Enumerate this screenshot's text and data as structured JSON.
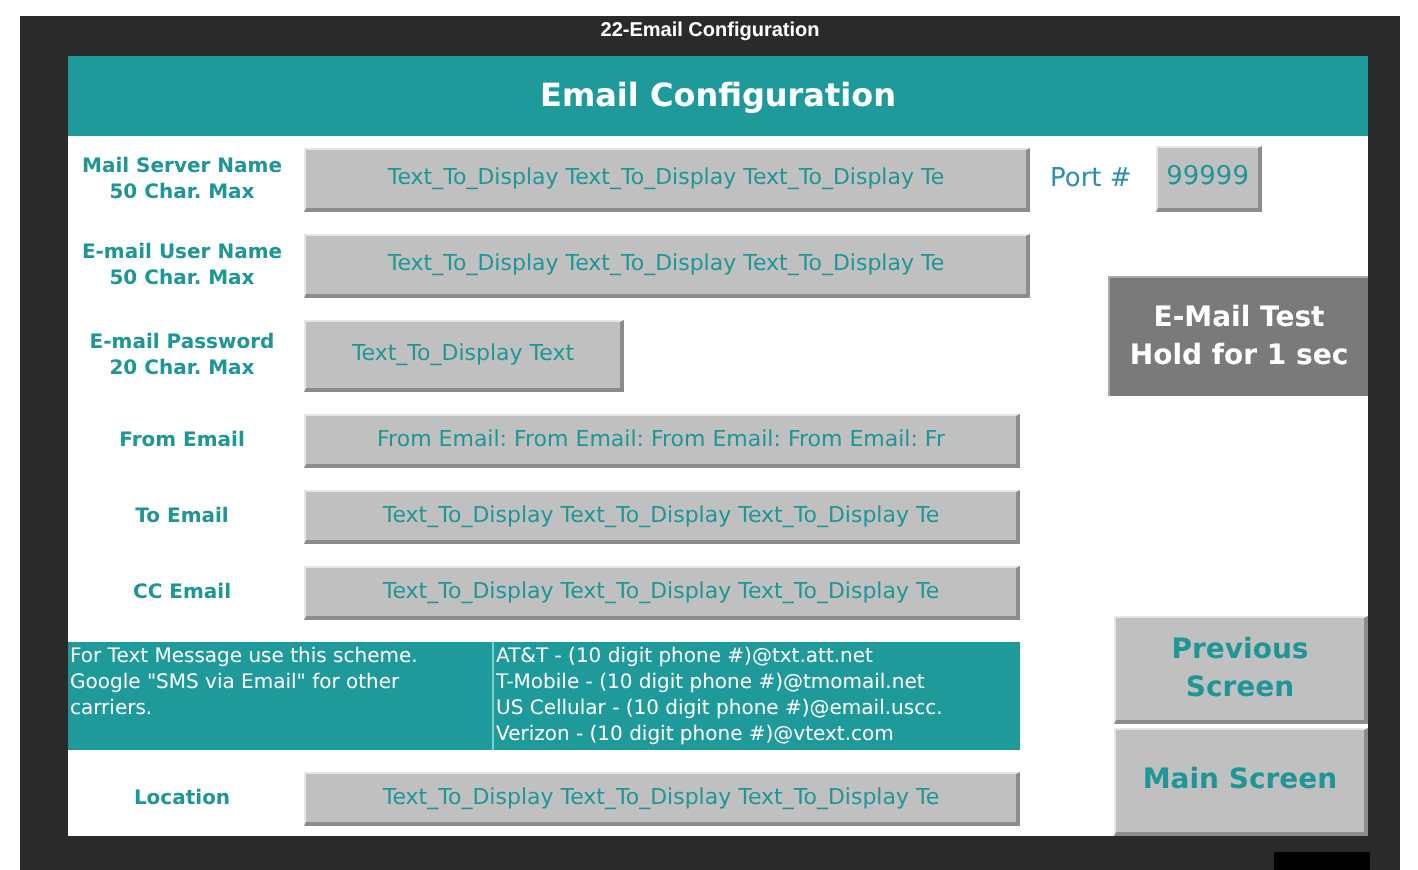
{
  "window": {
    "title": "22-Email Configuration"
  },
  "header": "Email Configuration",
  "fields": [
    {
      "kind": "wide",
      "label_lines": [
        "Mail Server Name",
        "50 Char. Max"
      ],
      "value": "Text_To_Display Text_To_Display Text_To_Display Te",
      "port": {
        "label": "Port #",
        "value": "99999"
      }
    },
    {
      "kind": "wide",
      "label_lines": [
        "E-mail User Name",
        "50 Char. Max"
      ],
      "value": "Text_To_Display Text_To_Display Text_To_Display Te"
    },
    {
      "kind": "short",
      "label_lines": [
        "E-mail Password",
        "20 Char. Max"
      ],
      "value": "Text_To_Display Text"
    },
    {
      "kind": "medium",
      "label_lines": [
        "From Email"
      ],
      "value": "From Email: From Email: From Email: From Email: Fr"
    },
    {
      "kind": "medium",
      "label_lines": [
        "To Email"
      ],
      "value": "Text_To_Display Text_To_Display Text_To_Display Te"
    },
    {
      "kind": "medium",
      "label_lines": [
        "CC Email"
      ],
      "value": "Text_To_Display Text_To_Display Text_To_Display Te"
    },
    {
      "kind": "note",
      "text": "For Text Message use this scheme. Google \"SMS via Email\" for other carriers.",
      "lines": [
        "AT&T - (10 digit phone #)@txt.att.net",
        "T-Mobile - (10 digit phone #)@tmomail.net",
        "US Cellular - (10 digit phone #)@email.uscc.",
        "Verizon - (10 digit phone #)@vtext.com"
      ]
    },
    {
      "kind": "medium",
      "label_lines": [
        "Location"
      ],
      "value": "Text_To_Display Text_To_Display Text_To_Display Te"
    }
  ],
  "test_button": {
    "lines": [
      "E-Mail Test",
      "Hold for 1 sec"
    ]
  },
  "nav_buttons": [
    {
      "lines": [
        "Previous",
        "Screen"
      ]
    },
    {
      "lines": [
        "Main Screen"
      ]
    }
  ]
}
